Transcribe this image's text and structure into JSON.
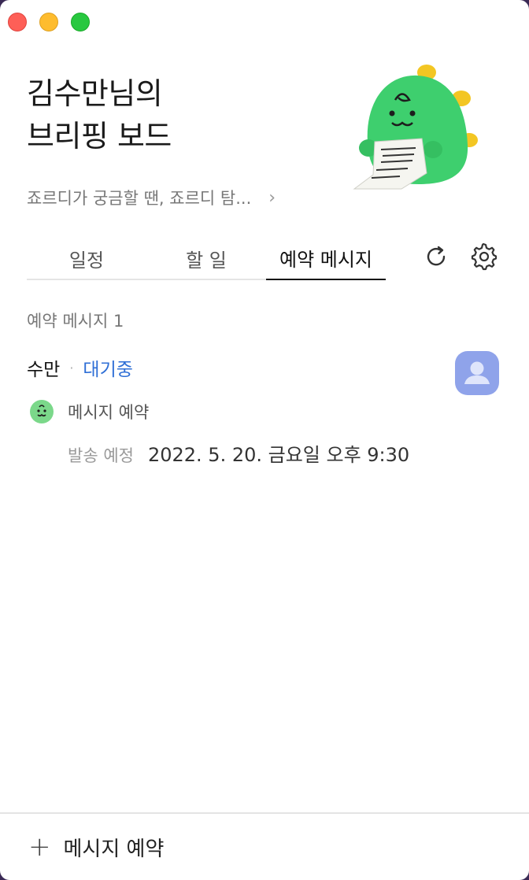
{
  "window": {
    "controls": [
      "close",
      "minimize",
      "maximize"
    ]
  },
  "header": {
    "title_line1": "김수만님의",
    "title_line2": "브리핑 보드",
    "subtitle": "죠르디가 궁금할 땐, 죠르디 탐...",
    "subtitle_chevron": "›",
    "mascot_icon": "jordy-mascot-icon"
  },
  "tabs": [
    {
      "label": "일정",
      "active": false
    },
    {
      "label": "할 일",
      "active": false
    },
    {
      "label": "예약 메시지",
      "active": true
    }
  ],
  "toolbar": {
    "refresh_icon": "refresh-icon",
    "settings_icon": "gear-icon"
  },
  "list": {
    "count_label": "예약 메시지 1",
    "items": [
      {
        "name": "수만",
        "separator": "·",
        "status": "대기중",
        "status_color": "#2f6fd6",
        "avatar_icon": "person-avatar-icon",
        "type_label": "메시지 예약",
        "type_icon": "jordy-face-icon",
        "schedule_key": "발송 예정",
        "schedule_value": "2022. 5. 20. 금요일 오후 9:30"
      }
    ]
  },
  "footer": {
    "plus": "+",
    "label": "메시지 예약"
  },
  "colors": {
    "accent": "#2f6fd6",
    "mascot_green": "#3ecf6e",
    "avatar_bg": "#8fa3ea"
  }
}
